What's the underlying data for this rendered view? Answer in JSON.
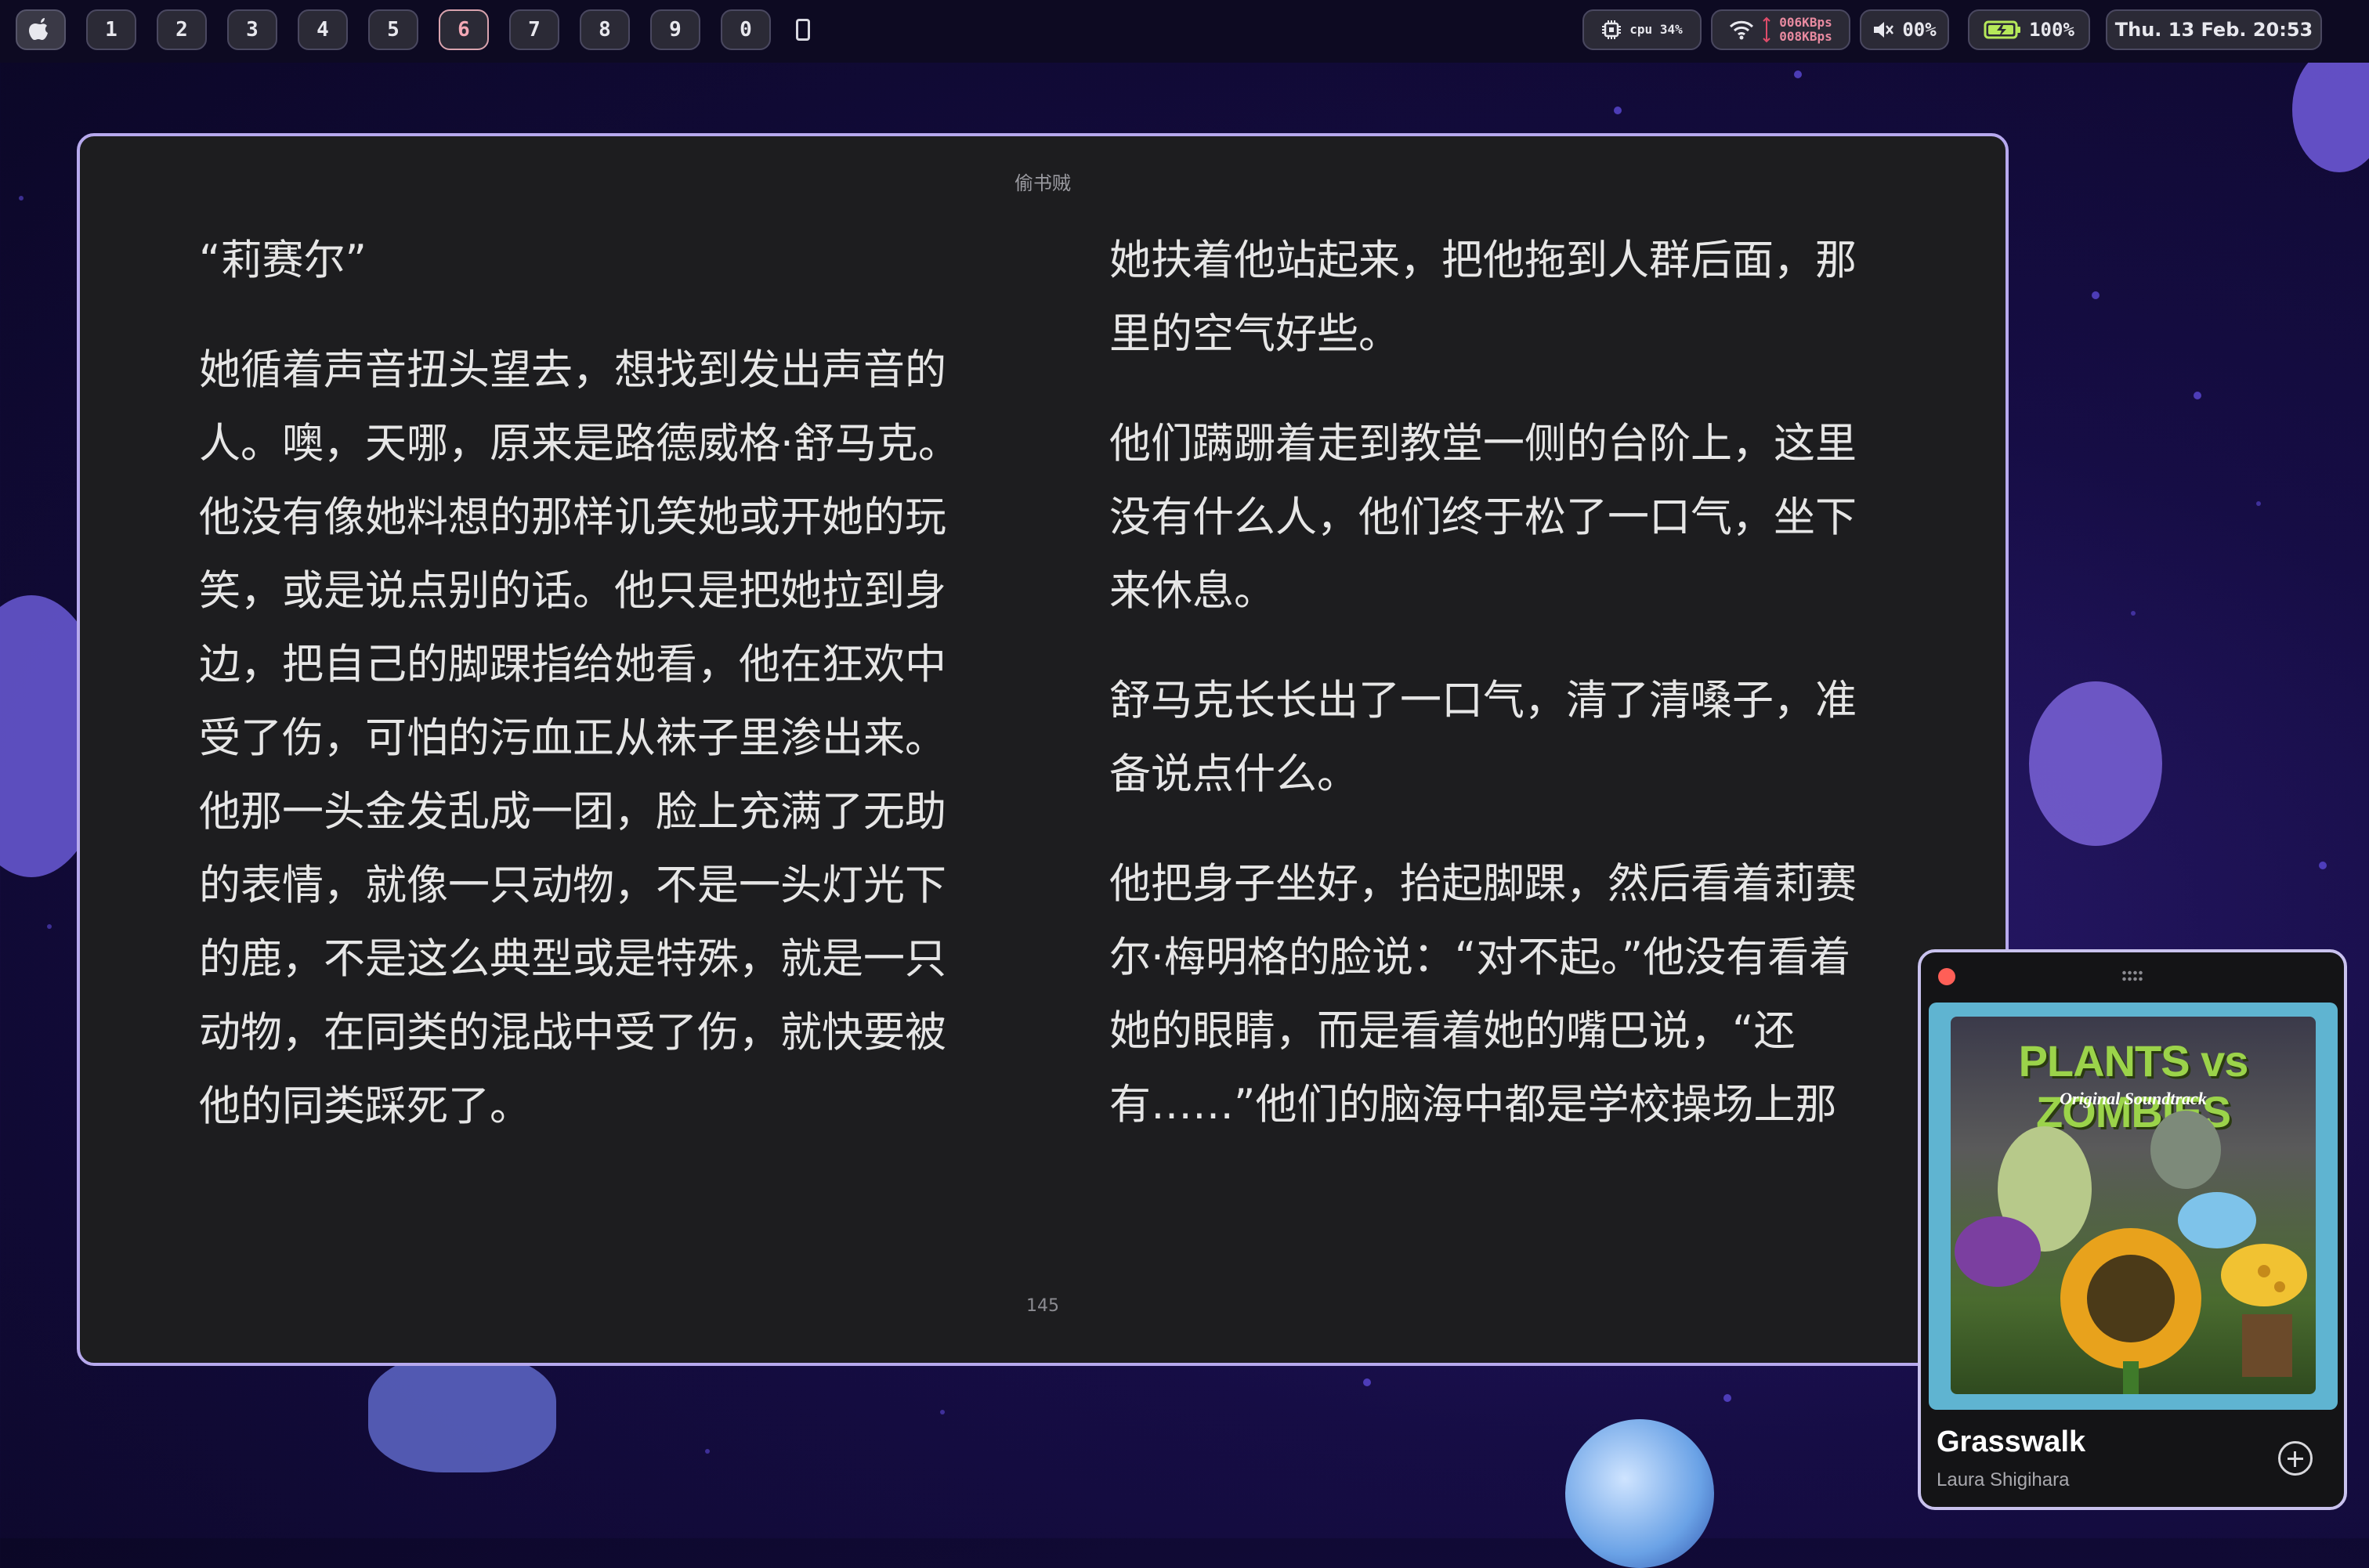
{
  "topbar": {
    "workspaces": [
      "1",
      "2",
      "3",
      "4",
      "5",
      "6",
      "7",
      "8",
      "9",
      "0"
    ],
    "active_workspace": "6",
    "cpu_label": "cpu",
    "cpu_value": "34%",
    "net_up": "006KBps",
    "net_down": "008KBps",
    "volume": "00%",
    "battery": "100%",
    "datetime": "Thu. 13 Feb. 20:53"
  },
  "reader": {
    "book_title": "偷书贼",
    "left_paragraphs": [
      "“莉赛尔”",
      "她循着声音扭头望去，想找到发出声音的人。噢，天哪，原来是路德威格·舒马克。他没有像她料想的那样讥笑她或开她的玩笑，或是说点别的话。他只是把她拉到身边，把自己的脚踝指给她看，他在狂欢中受了伤，可怕的污血正从袜子里渗出来。他那一头金发乱成一团，脸上充满了无助的表情，就像一只动物，不是一头灯光下的鹿，不是这么典型或是特殊，就是一只动物，在同类的混战中受了伤，就快要被他的同类踩死了。"
    ],
    "right_paragraphs": [
      "她扶着他站起来，把他拖到人群后面，那里的空气好些。",
      "他们蹒跚着走到教堂一侧的台阶上，这里没有什么人，他们终于松了一口气，坐下来休息。",
      "舒马克长长出了一口气，清了清嗓子，准备说点什么。",
      "他把身子坐好，抬起脚踝，然后看着莉赛尔·梅明格的脸说：“对不起。”他没有看着她的眼睛，而是看着她的嘴巴说，“还有……”他们的脑海中都是学校操场上那"
    ],
    "page_number": "145"
  },
  "player": {
    "album_art_title": "PLANTS vs ZOMBIES",
    "album_art_subtitle": "Original Soundtrack",
    "song_title": "Grasswalk",
    "artist": "Laura Shigihara"
  },
  "colors": {
    "window_border": "#b7a9ee",
    "close_dot": "#ff5f57",
    "active_workspace": "#f4a8b6"
  }
}
